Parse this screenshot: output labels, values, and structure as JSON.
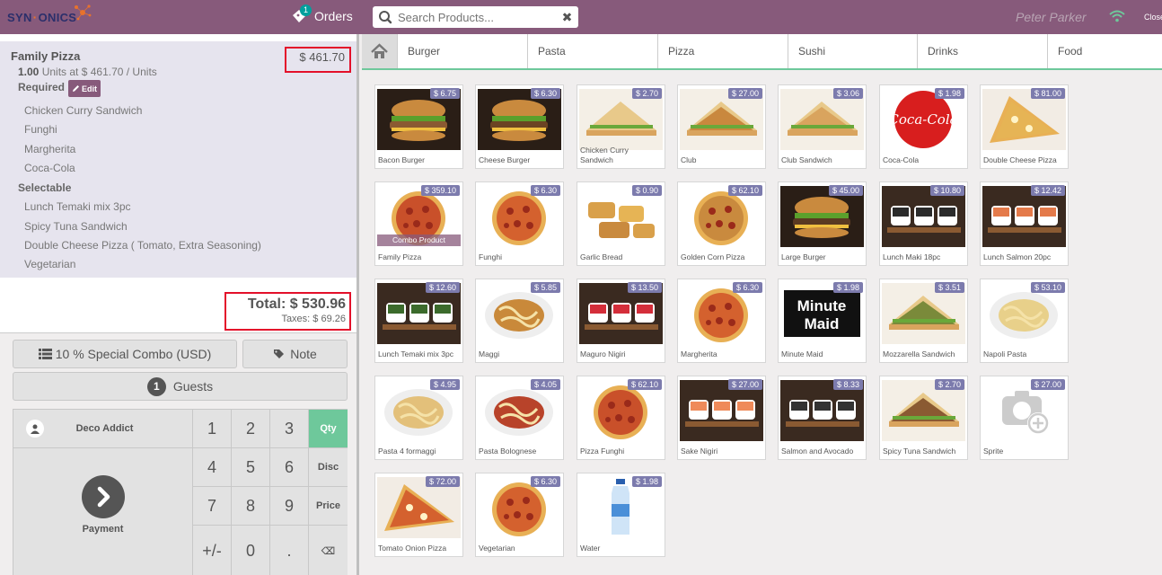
{
  "topbar": {
    "logo_left": "SYN",
    "logo_mid": "·",
    "logo_right": "ONICS",
    "orders_label": "Orders",
    "orders_count": "1",
    "search_placeholder": "Search Products...",
    "user_name": "Peter Parker",
    "close_label": "Close"
  },
  "order": {
    "line_name": "Family Pizza",
    "line_price": "$ 461.70",
    "line_qty": "1.00",
    "line_unit_text": "Units at $ 461.70 / Units",
    "required_label": "Required",
    "edit_label": "Edit",
    "required_items": [
      "Chicken Curry Sandwich",
      "Funghi",
      "Margherita",
      "Coca-Cola"
    ],
    "selectable_label": "Selectable",
    "selectable_items": [
      "Lunch Temaki mix 3pc",
      "Spicy Tuna Sandwich",
      "Double Cheese Pizza ( Tomato, Extra Seasoning)",
      "Vegetarian"
    ],
    "total_label": "Total: $ 530.96",
    "taxes_label": "Taxes: $ 69.26"
  },
  "controls": {
    "pricelist_label": "10 % Special Combo (USD)",
    "note_label": "Note",
    "guests_count": "1",
    "guests_label": "Guests",
    "customer_name": "Deco Addict",
    "payment_label": "Payment",
    "keys": [
      "1",
      "2",
      "3",
      "Qty",
      "4",
      "5",
      "6",
      "Disc",
      "7",
      "8",
      "9",
      "Price",
      "+/-",
      "0",
      ".",
      "⌫"
    ]
  },
  "categories": [
    "Burger",
    "Pasta",
    "Pizza",
    "Sushi",
    "Drinks",
    "Food"
  ],
  "products": [
    {
      "name": "Bacon Burger",
      "price": "$ 6.75",
      "icon": "burger",
      "color": "#8a5a32"
    },
    {
      "name": "Cheese Burger",
      "price": "$ 6.30",
      "icon": "burger",
      "color": "#6b4423"
    },
    {
      "name": "Chicken Curry Sandwich",
      "price": "$ 2.70",
      "icon": "sandwich",
      "color": "#e8c98a"
    },
    {
      "name": "Club",
      "price": "$ 27.00",
      "icon": "sandwich",
      "color": "#c9883e"
    },
    {
      "name": "Club Sandwich",
      "price": "$ 3.06",
      "icon": "sandwich",
      "color": "#d9a45e"
    },
    {
      "name": "Coca-Cola",
      "price": "$ 1.98",
      "icon": "coke",
      "color": "#d81e1e"
    },
    {
      "name": "Double Cheese Pizza",
      "price": "$ 81.00",
      "icon": "pizza-slice",
      "color": "#e6b455"
    },
    {
      "name": "Family Pizza",
      "price": "$ 359.10",
      "icon": "pizza",
      "color": "#c9502a",
      "combo": "Combo Product"
    },
    {
      "name": "Funghi",
      "price": "$ 6.30",
      "icon": "pizza",
      "color": "#d4612e"
    },
    {
      "name": "Garlic Bread",
      "price": "$ 0.90",
      "icon": "bread",
      "color": "#d9a04a"
    },
    {
      "name": "Golden Corn Pizza",
      "price": "$ 62.10",
      "icon": "pizza",
      "color": "#c98a3e"
    },
    {
      "name": "Large Burger",
      "price": "$ 45.00",
      "icon": "burger",
      "color": "#5a3a22"
    },
    {
      "name": "Lunch Maki 18pc",
      "price": "$ 10.80",
      "icon": "sushi",
      "color": "#2b2b2b"
    },
    {
      "name": "Lunch Salmon 20pc",
      "price": "$ 12.42",
      "icon": "sushi",
      "color": "#e47a4a"
    },
    {
      "name": "Lunch Temaki mix 3pc",
      "price": "$ 12.60",
      "icon": "sushi",
      "color": "#3c6b2c"
    },
    {
      "name": "Maggi",
      "price": "$ 5.85",
      "icon": "pasta",
      "color": "#c9893a"
    },
    {
      "name": "Maguro Nigiri",
      "price": "$ 13.50",
      "icon": "sushi",
      "color": "#d42e3a"
    },
    {
      "name": "Margherita",
      "price": "$ 6.30",
      "icon": "pizza",
      "color": "#d4612e"
    },
    {
      "name": "Minute Maid",
      "price": "$ 1.98",
      "icon": "minute-maid",
      "color": "#111111"
    },
    {
      "name": "Mozzarella Sandwich",
      "price": "$ 3.51",
      "icon": "sandwich",
      "color": "#7a8a3a"
    },
    {
      "name": "Napoli Pasta",
      "price": "$ 53.10",
      "icon": "pasta",
      "color": "#e8d08a"
    },
    {
      "name": "Pasta 4 formaggi",
      "price": "$ 4.95",
      "icon": "pasta",
      "color": "#e3c07a"
    },
    {
      "name": "Pasta Bolognese",
      "price": "$ 4.05",
      "icon": "pasta",
      "color": "#b8432a"
    },
    {
      "name": "Pizza Funghi",
      "price": "$ 62.10",
      "icon": "pizza",
      "color": "#c9502a"
    },
    {
      "name": "Sake Nigiri",
      "price": "$ 27.00",
      "icon": "sushi",
      "color": "#ef8a5a"
    },
    {
      "name": "Salmon and Avocado",
      "price": "$ 8.33",
      "icon": "sushi",
      "color": "#333333"
    },
    {
      "name": "Spicy Tuna Sandwich",
      "price": "$ 2.70",
      "icon": "sandwich",
      "color": "#8a5a32"
    },
    {
      "name": "Sprite",
      "price": "$ 27.00",
      "icon": "placeholder-camera",
      "color": "#cccccc"
    },
    {
      "name": "Tomato Onion Pizza",
      "price": "$ 72.00",
      "icon": "pizza-slice",
      "color": "#d4612e"
    },
    {
      "name": "Vegetarian",
      "price": "$ 6.30",
      "icon": "pizza",
      "color": "#d4612e"
    },
    {
      "name": "Water",
      "price": "$ 1.98",
      "icon": "water-bottle",
      "color": "#4a8fd8"
    }
  ],
  "colors": {
    "brand": "#875a7b",
    "accent": "#6ec89b",
    "price_badge": "#7c7bad",
    "highlight": "#e3102a"
  }
}
